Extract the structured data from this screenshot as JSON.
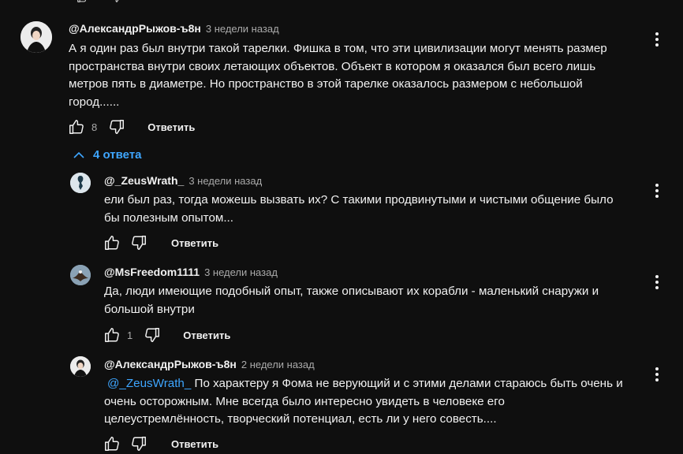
{
  "comments": {
    "main": {
      "author": "@АлександрРыжов-ъ8н",
      "time": "3 недели назад",
      "lines": [
        "А я один раз был внутри такой тарелки.   Фишка в том, что эти цивилизации могут менять размер",
        "пространства внутри своих летающих объектов. Объект в котором я оказался был всего лишь",
        "метров пять в диаметре. Но пространство в этой тарелке оказалось размером с небольшой",
        "город......"
      ],
      "likes": "8",
      "reply_label": "Ответить"
    },
    "replies_toggle": "4 ответа",
    "reply1": {
      "author": "@_ZeusWrath_",
      "time": "3 недели назад",
      "lines": [
        "ели был раз, тогда можешь вызвать их? С такими продвинутыми и чистыми общение было",
        "бы полезным опытом..."
      ],
      "reply_label": "Ответить"
    },
    "reply2": {
      "author": "@MsFreedom1111",
      "time": "3 недели назад",
      "lines": [
        "Да, люди имеющие подобный опыт, также описывают их корабли - маленький снаружи и",
        "большой внутри"
      ],
      "likes": "1",
      "reply_label": "Ответить"
    },
    "reply3": {
      "author": "@АлександрРыжов-ъ8н",
      "time": "2 недели назад",
      "mention": "@_ZeusWrath_",
      "line1_rest": " По характеру я Фома не верующий и с этими делами стараюсь быть очень и",
      "lines": [
        "очень осторожным. Мне всегда было интересно увидеть в человеке его",
        "целеустремлённость, творческий потенциал, есть ли у него совесть...."
      ],
      "reply_label": "Ответить"
    }
  },
  "icons": {
    "like": "thumb-up-icon",
    "dislike": "thumb-down-icon",
    "menu": "more-vert-icon",
    "collapse": "chevron-up-icon"
  },
  "colors": {
    "background": "#0f0f0f",
    "text": "#f1f1f1",
    "secondary": "#aaaaaa",
    "link": "#3ea6ff"
  }
}
